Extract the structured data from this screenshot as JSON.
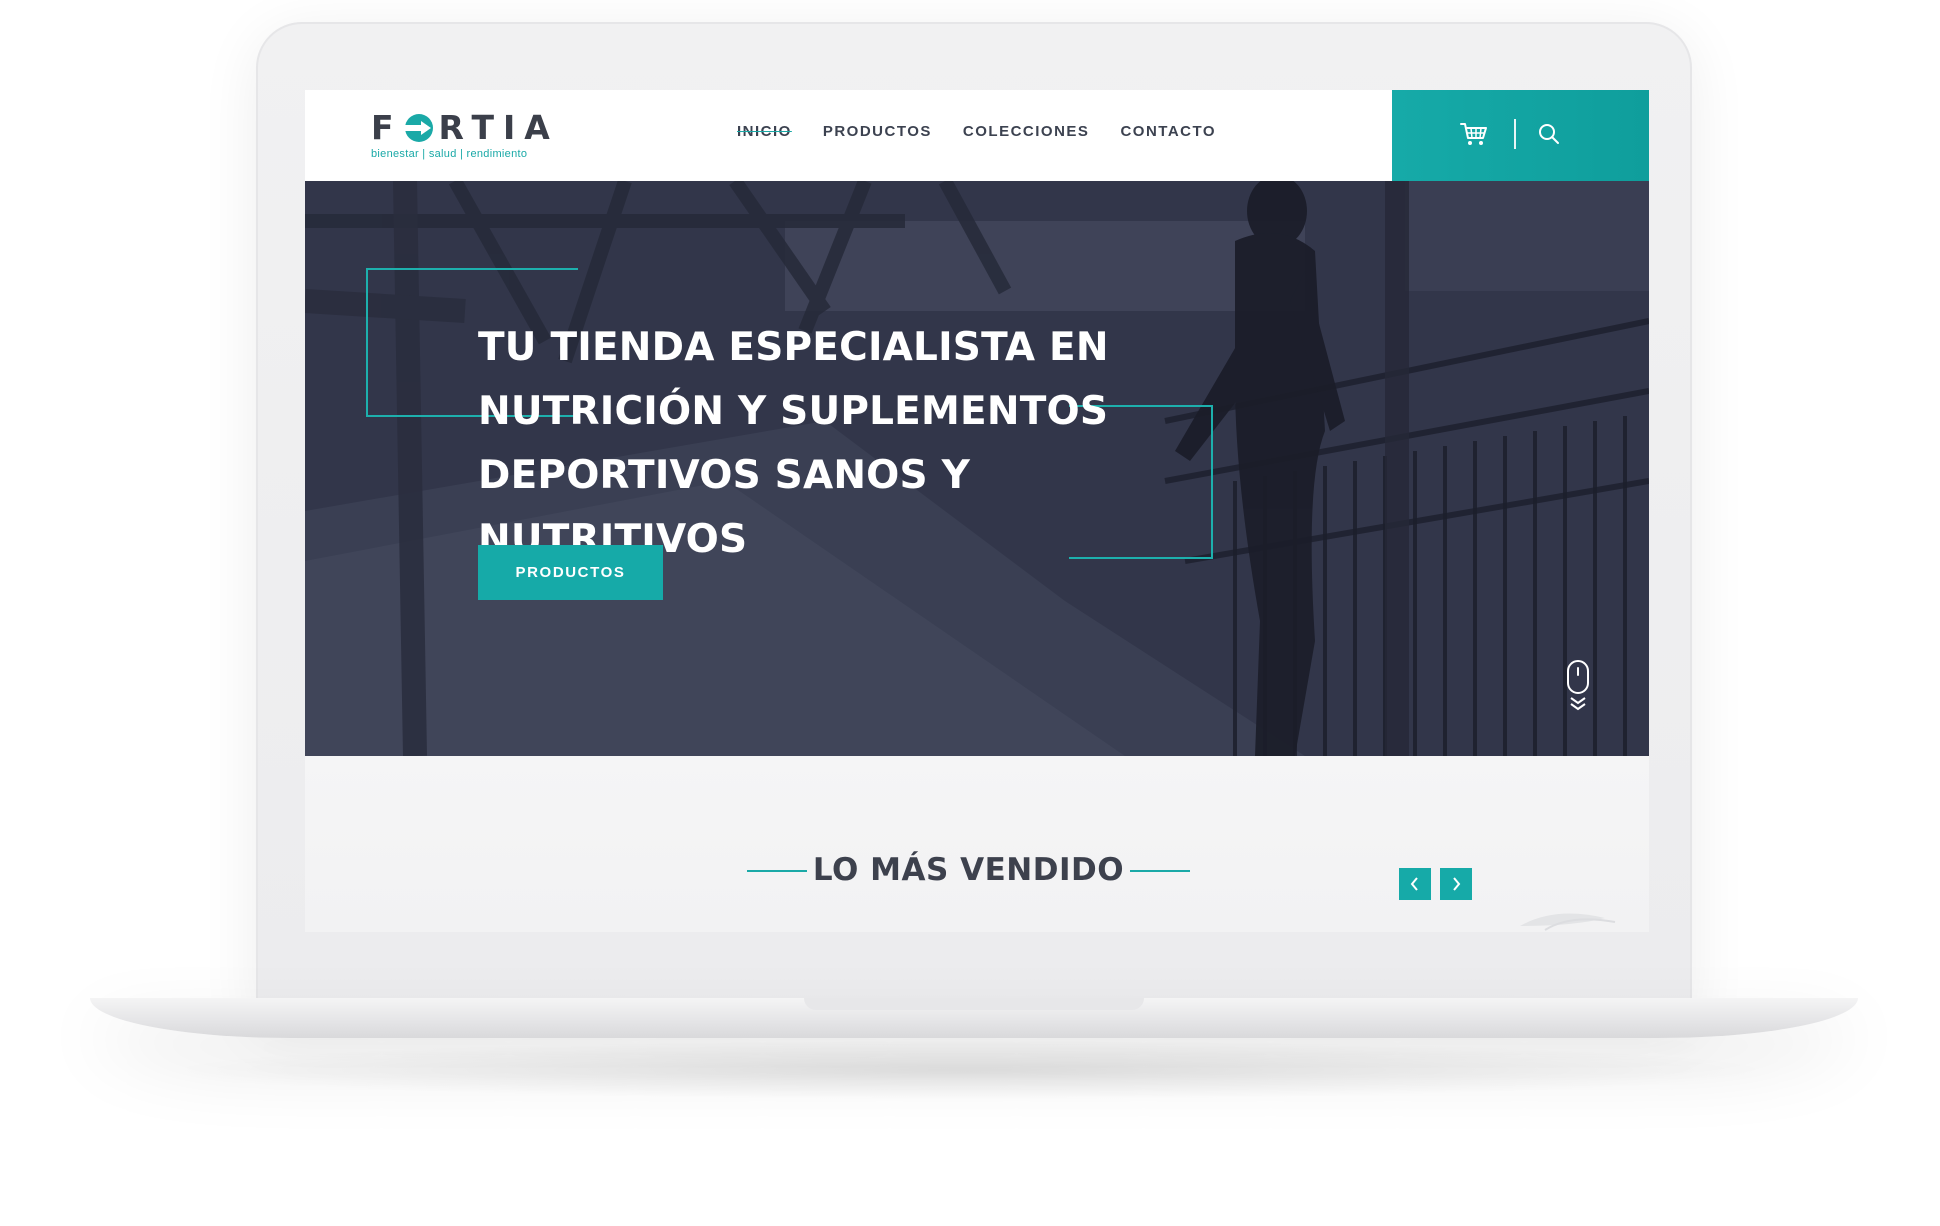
{
  "brand": {
    "name_left": "F",
    "name_right": "RTIA",
    "tagline": "bienestar | salud | rendimiento"
  },
  "nav": {
    "items": [
      {
        "label": "INICIO",
        "active": true
      },
      {
        "label": "PRODUCTOS",
        "active": false
      },
      {
        "label": "COLECCIONES",
        "active": false
      },
      {
        "label": "CONTACTO",
        "active": false
      }
    ]
  },
  "header_actions": {
    "cart_icon": "shopping-cart-icon",
    "search_icon": "search-icon"
  },
  "hero": {
    "title_lines": [
      "TU TIENDA ESPECIALISTA EN",
      "NUTRICIÓN Y SUPLEMENTOS",
      "DEPORTIVOS SANOS Y NUTRITIVOS"
    ],
    "cta_label": "PRODUCTOS",
    "scroll_icon": "mouse-scroll-icon"
  },
  "bestsellers": {
    "title": "LO MÁS VENDIDO",
    "prev_icon": "chevron-left-icon",
    "next_icon": "chevron-right-icon"
  },
  "colors": {
    "accent": "#16aaa8",
    "text_dark": "#3c4250",
    "hero_overlay": "#2d3142"
  }
}
